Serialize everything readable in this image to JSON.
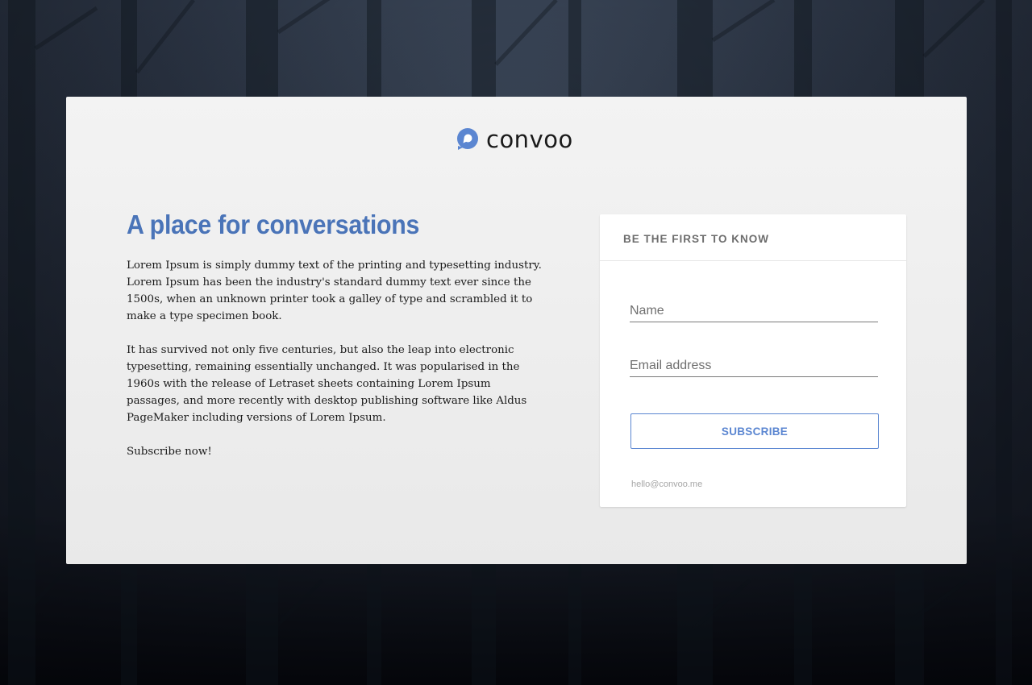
{
  "brand": {
    "name": "convoo",
    "logo_icon": "chat-bubble-icon",
    "accent_color": "#5b86d1"
  },
  "hero": {
    "headline": "A place for conversations",
    "headline_color": "#4a74b8",
    "paragraphs": [
      "Lorem Ipsum is simply dummy text of the printing and typesetting industry. Lorem Ipsum has been the industry's standard dummy text ever since the 1500s, when an unknown printer took a galley of type and scrambled it to make a type specimen book.",
      "It has survived not only five centuries, but also the leap into electronic typesetting, remaining essentially unchanged. It was popularised in the 1960s with the release of Letraset sheets containing Lorem Ipsum passages, and more recently with desktop publishing software like Aldus PageMaker including versions of Lorem Ipsum.",
      "Subscribe now!"
    ]
  },
  "signup": {
    "heading": "BE THE FIRST TO KNOW",
    "name_placeholder": "Name",
    "name_value": "",
    "email_placeholder": "Email address",
    "email_value": "",
    "submit_label": "SUBSCRIBE",
    "contact_email": "hello@convoo.me"
  }
}
